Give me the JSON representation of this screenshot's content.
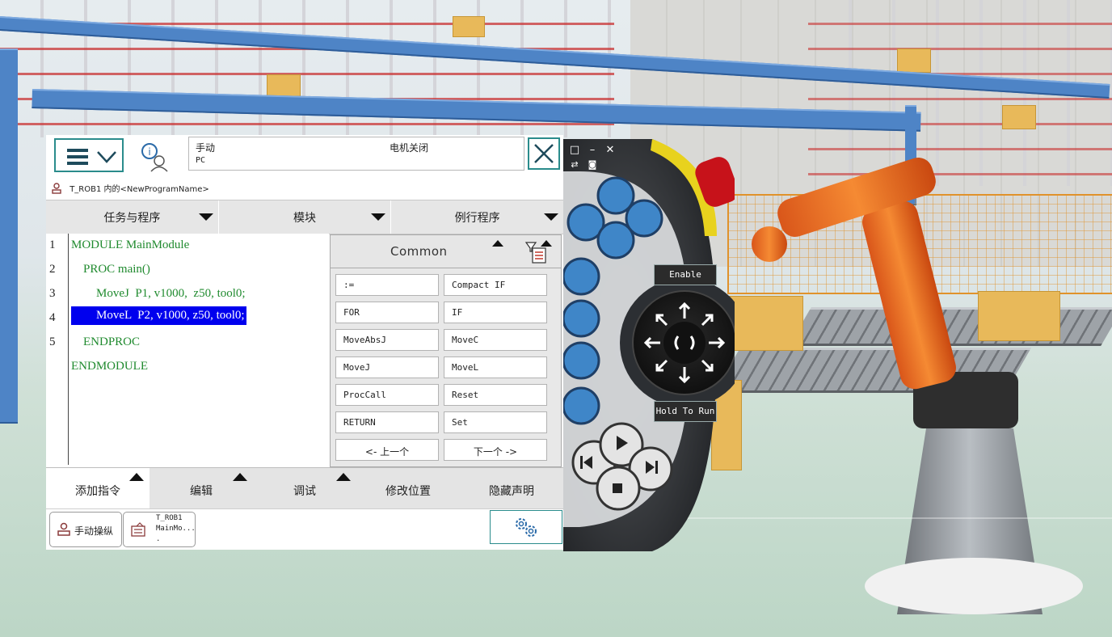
{
  "status_bar": {
    "mode": "手动",
    "source": "PC",
    "motor_state": "电机关闭"
  },
  "breadcrumb": "T_ROB1 内的<NewProgramName>",
  "tabs": [
    {
      "label": "任务与程序"
    },
    {
      "label": "模块"
    },
    {
      "label": "例行程序"
    }
  ],
  "editor": {
    "line_numbers": [
      "1",
      "2",
      "3",
      "4",
      "5"
    ],
    "lines": [
      "MODULE MainModule",
      "PROC main()",
      "MoveJ  P1, v1000,  z50, tool0;",
      "MoveL  P2, v1000, z50, tool0;",
      "ENDPROC",
      "ENDMODULE"
    ],
    "selected_line": 4
  },
  "instruction_panel": {
    "title": "Common",
    "buttons": [
      ":=",
      "Compact IF",
      "FOR",
      "IF",
      "MoveAbsJ",
      "MoveC",
      "MoveJ",
      "MoveL",
      "ProcCall",
      "Reset",
      "RETURN",
      "Set"
    ],
    "prev_label": "<-   上一个",
    "next_label": "下一个   ->"
  },
  "bottom_menu": [
    {
      "label": "添加指令",
      "active": true
    },
    {
      "label": "编辑"
    },
    {
      "label": "调试"
    },
    {
      "label": "修改位置"
    },
    {
      "label": "隐藏声明"
    }
  ],
  "taskbar": {
    "jog_label": "手动操纵",
    "task_line1": "T_ROB1",
    "task_line2": "MainMo...",
    "task_line3": "."
  },
  "pendant": {
    "enable_label": "Enable",
    "hold_label": "Hold To Run"
  },
  "colors": {
    "accent": "#2a8c8c",
    "code_green": "#1f8a2e",
    "selection": "#0000ee",
    "robot_orange": "#f07d28"
  }
}
